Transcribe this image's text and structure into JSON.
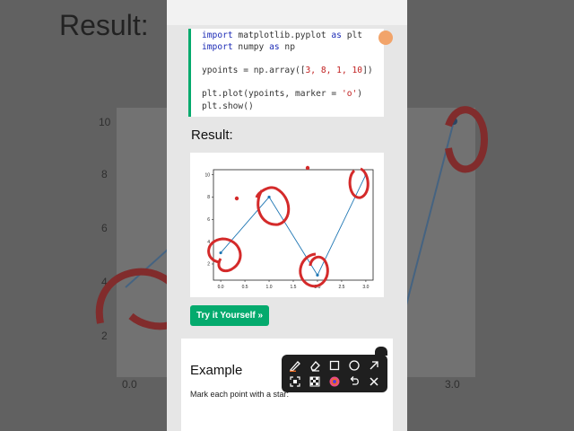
{
  "background": {
    "title": "Result:",
    "y_ticks": [
      "10",
      "8",
      "6",
      "4",
      "2"
    ],
    "x_ticks": [
      "0.0",
      "3.0"
    ]
  },
  "code": {
    "line1_kw": "import",
    "line1_rest": " matplotlib.pyplot ",
    "line1_kw2": "as",
    "line1_end": " plt",
    "line2_kw": "import",
    "line2_rest": " numpy ",
    "line2_kw2": "as",
    "line2_end": " np",
    "line3_pre": "ypoints = np.array([",
    "line3_nums": "3, 8, 1, 10",
    "line3_post": "])",
    "line4_pre": "plt.plot(ypoints, marker = ",
    "line4_str": "'o'",
    "line4_post": ")",
    "line5": "plt.show()"
  },
  "result_label": "Result:",
  "try_button": "Try it Yourself »",
  "example": {
    "title": "Example",
    "text": "Mark each point with a star:"
  },
  "chart_data": {
    "type": "line",
    "x": [
      0,
      1,
      2,
      3
    ],
    "y": [
      3,
      8,
      1,
      10
    ],
    "marker": "o",
    "x_ticks": [
      "0.0",
      "0.5",
      "1.0",
      "1.5",
      "2.0",
      "2.5",
      "3.0"
    ],
    "y_ticks": [
      "2",
      "4",
      "6",
      "8",
      "10"
    ],
    "xlim": [
      -0.15,
      3.15
    ],
    "ylim": [
      0.55,
      10.45
    ],
    "line_color": "#1f77b4"
  },
  "toolbar": {
    "tools": [
      "pen-icon",
      "eraser-icon",
      "rectangle-icon",
      "circle-icon",
      "arrow-icon",
      "screenshot-icon",
      "mosaic-icon",
      "color-icon",
      "undo-icon",
      "close-icon"
    ]
  },
  "colors": {
    "accent": "#04aa6d",
    "annotation": "#d42a2a",
    "toolbar": "#1f1f1f",
    "pen": "#f26b1f"
  }
}
